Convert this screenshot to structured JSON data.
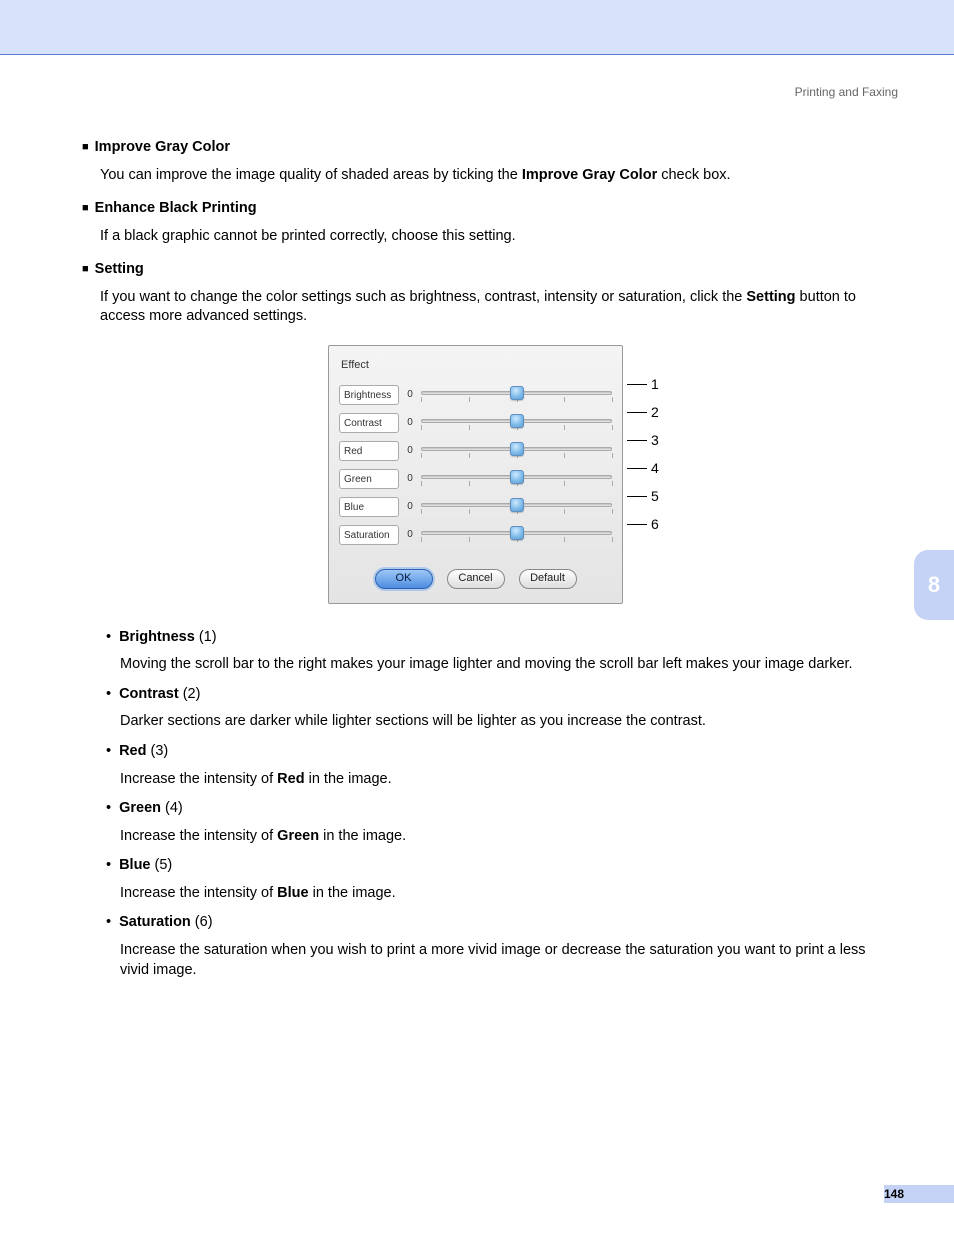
{
  "header": {
    "section": "Printing and Faxing"
  },
  "sideTab": "8",
  "pageNumber": "148",
  "sections": {
    "improveGray": {
      "title": "Improve Gray Color",
      "body_pre": "You can improve the image quality of shaded areas by ticking the ",
      "body_bold": "Improve Gray Color",
      "body_post": " check box."
    },
    "enhanceBlack": {
      "title": "Enhance Black Printing",
      "body": "If a black graphic cannot be printed correctly, choose this setting."
    },
    "setting": {
      "title": "Setting",
      "body_pre": "If you want to change the color settings such as brightness, contrast, intensity or saturation, click  the ",
      "body_bold": "Setting",
      "body_post": " button to access more advanced settings."
    }
  },
  "dialog": {
    "title": "Effect",
    "sliders": [
      {
        "label": "Brightness",
        "value": "0",
        "callout": "1"
      },
      {
        "label": "Contrast",
        "value": "0",
        "callout": "2"
      },
      {
        "label": "Red",
        "value": "0",
        "callout": "3"
      },
      {
        "label": "Green",
        "value": "0",
        "callout": "4"
      },
      {
        "label": "Blue",
        "value": "0",
        "callout": "5"
      },
      {
        "label": "Saturation",
        "value": "0",
        "callout": "6"
      }
    ],
    "buttons": {
      "ok": "OK",
      "cancel": "Cancel",
      "default": "Default"
    }
  },
  "details": [
    {
      "name": "Brightness",
      "num": "(1)",
      "body_pre": "Moving the scroll bar to the right makes your image lighter and moving the scroll bar left makes your image darker.",
      "body_bold": "",
      "body_post": ""
    },
    {
      "name": "Contrast",
      "num": "(2)",
      "body_pre": "Darker sections are darker while lighter sections will be lighter as you increase the contrast.",
      "body_bold": "",
      "body_post": ""
    },
    {
      "name": "Red",
      "num": "(3)",
      "body_pre": "Increase the intensity of ",
      "body_bold": "Red",
      "body_post": " in the image."
    },
    {
      "name": "Green",
      "num": "(4)",
      "body_pre": "Increase the intensity of ",
      "body_bold": "Green",
      "body_post": " in the image."
    },
    {
      "name": "Blue",
      "num": "(5)",
      "body_pre": "Increase the intensity of ",
      "body_bold": "Blue",
      "body_post": " in the image."
    },
    {
      "name": "Saturation",
      "num": "(6)",
      "body_pre": "Increase the saturation when you wish to print a more vivid image or decrease the saturation you want to print a less vivid image.",
      "body_bold": "",
      "body_post": ""
    }
  ]
}
